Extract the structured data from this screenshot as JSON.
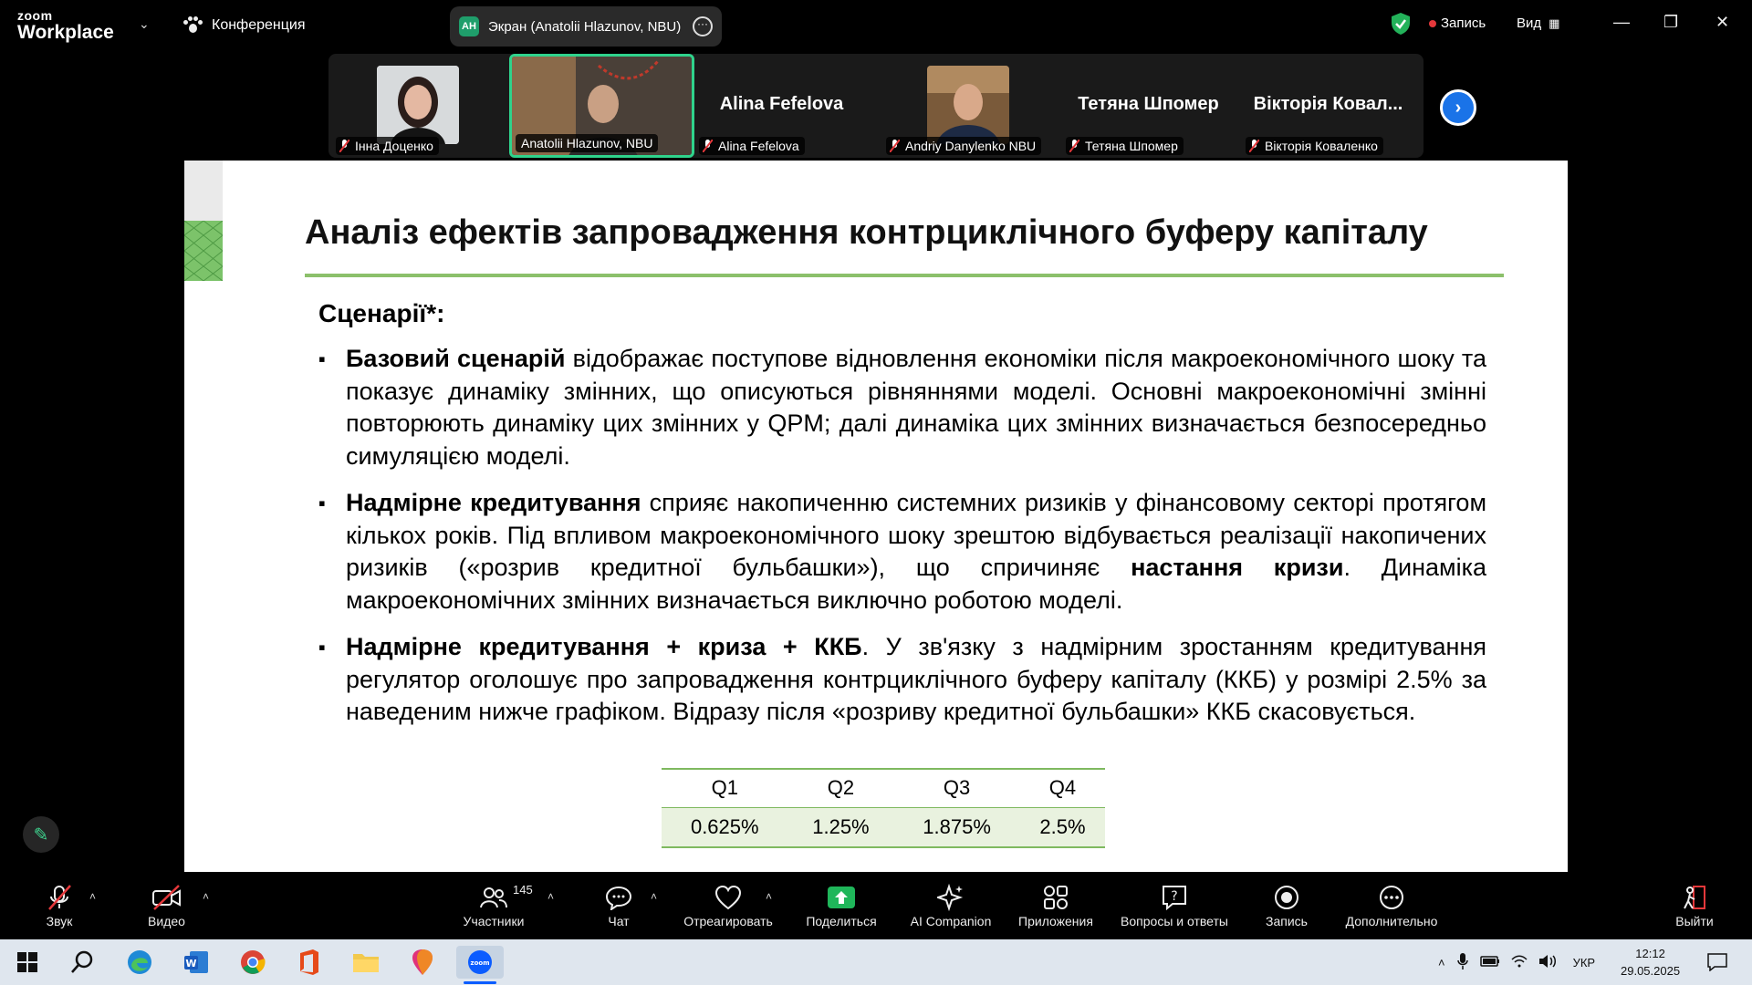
{
  "topbar": {
    "logo_small": "zoom",
    "logo_big": "Workplace",
    "conference_label": "Конференция",
    "screen_share_initials": "AH",
    "screen_share_label": "Экран (Anatolii Hlazunov, NBU)",
    "record_label": "Запись",
    "view_label": "Вид"
  },
  "participants": [
    {
      "name": "Інна Доценко",
      "muted": true,
      "video": true
    },
    {
      "name": "Anatolii Hlazunov, NBU",
      "muted": false,
      "video": true,
      "active": true
    },
    {
      "name": "Alina Fefelova",
      "big_name": "Alina Fefelova",
      "muted": true,
      "video": false
    },
    {
      "name": "Andriy Danylenko NBU",
      "muted": true,
      "video": true
    },
    {
      "name": "Тетяна Шпомер",
      "big_name": "Тетяна Шпомер",
      "muted": true,
      "video": false
    },
    {
      "name": "Вікторія Коваленко",
      "big_name": "Вікторія Ковал...",
      "muted": true,
      "video": false
    }
  ],
  "slide": {
    "title": "Аналіз ефектів запровадження контрциклічного буферу капіталу",
    "scenarios_heading": "Сценарії*:",
    "bullets": [
      {
        "bold": "Базовий сценарій",
        "text": " відображає поступове відновлення економіки після макроекономічного шоку та показує динаміку змінних, що описуються рівняннями моделі. Основні макроекономічні змінні повторюють динаміку цих змінних у QPM; далі динаміка цих змінних визначається безпосередньо симуляцією моделі."
      },
      {
        "bold": "Надмірне кредитування",
        "text": " сприяє накопиченню системних ризиків у фінансовому секторі протягом кількох років. Під впливом макроекономічного шоку зрештою відбувається реалізації накопичених ризиків («розрив кредитної бульбашки»), що спричиняє ",
        "bold2": "настання кризи",
        "text2": ". Динаміка макроекономічних змінних визначається виключно роботою моделі."
      },
      {
        "bold": "Надмірне кредитування + криза + ККБ",
        "text": ". У зв'язку з надмірним зростанням кредитування регулятор оголошує про запровадження контрциклічного буферу капіталу (ККБ) у розмірі 2.5% за наведеним нижче графіком. Відразу після «розриву кредитної бульбашки» ККБ скасовується."
      }
    ],
    "table": {
      "headers": [
        "Q1",
        "Q2",
        "Q3",
        "Q4"
      ],
      "values": [
        "0.625%",
        "1.25%",
        "1.875%",
        "2.5%"
      ]
    }
  },
  "toolbar": {
    "audio": "Звук",
    "video": "Видео",
    "participants": "Участники",
    "participants_count": "145",
    "chat": "Чат",
    "react": "Отреагировать",
    "share": "Поделиться",
    "ai": "AI Companion",
    "apps": "Приложения",
    "qa": "Вопросы и ответы",
    "record": "Запись",
    "more": "Дополнительно",
    "leave": "Выйти"
  },
  "taskbar": {
    "lang": "УКР",
    "time": "12:12",
    "date": "29.05.2025"
  },
  "colors": {
    "accent_green": "#2fd38c",
    "slide_rule": "#8cc06b",
    "share_green": "#1fb65a",
    "next_blue": "#1a73e8"
  }
}
